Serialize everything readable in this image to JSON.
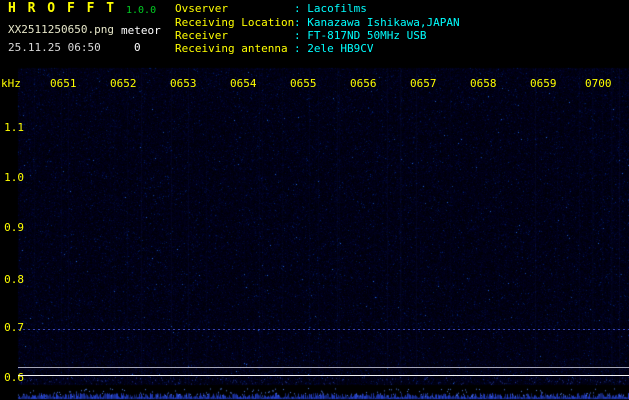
{
  "app": {
    "title": "H R O F F T",
    "version": "1.0.0",
    "filename": "XX2511250650.png",
    "mode": "meteor",
    "datetime": "25.11.25 06:50",
    "counter": "0"
  },
  "info": {
    "rows": [
      {
        "label": "Ovserver",
        "value": ": Lacofilms"
      },
      {
        "label": "Receiving Location",
        "value": ": Kanazawa Ishikawa,JAPAN"
      },
      {
        "label": "Receiver",
        "value": ": FT-817ND 50MHz USB"
      },
      {
        "label": "Receiving antenna",
        "value": ": 2ele HB9CV"
      }
    ]
  },
  "axes": {
    "freq_unit": "kHz",
    "freq_labels": [
      "1.1",
      "1.0",
      "0.9",
      "0.8",
      "0.7",
      "0.6"
    ],
    "time_labels": [
      "0651",
      "0652",
      "0653",
      "0654",
      "0655",
      "0656",
      "0657",
      "0658",
      "0659",
      "0700"
    ]
  },
  "colors": {
    "yellow": "#ffff00",
    "paleyellow": "#e6e6c8",
    "green": "#00cc22",
    "cyan": "#00ffff",
    "white": "#ffffff",
    "gray": "#d8d8d8"
  }
}
